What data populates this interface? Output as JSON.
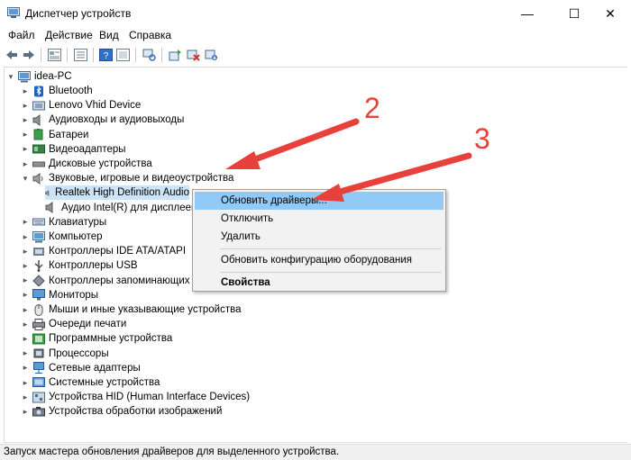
{
  "window": {
    "title": "Диспетчер устройств",
    "minimize": "—",
    "maximize": "☐",
    "close": "✕"
  },
  "menu": [
    "Файл",
    "Действие",
    "Вид",
    "Справка"
  ],
  "toolbar": {
    "icons": [
      "back-arrow-icon",
      "forward-arrow-icon",
      "properties-icon",
      "view-icon",
      "help-icon",
      "show-hidden-icon",
      "scan-hardware-icon",
      "update-driver-icon",
      "disable-device-icon",
      "uninstall-device-icon",
      "download-icon"
    ]
  },
  "tree": {
    "root": "idea-PC",
    "items": [
      {
        "label": "Bluetooth",
        "expanded": false,
        "icon": "bluetooth-icon"
      },
      {
        "label": "Lenovo Vhid Device",
        "expanded": false,
        "icon": "hid-device-icon"
      },
      {
        "label": "Аудиовходы и аудиовыходы",
        "expanded": false,
        "icon": "speaker-icon"
      },
      {
        "label": "Батареи",
        "expanded": false,
        "icon": "battery-icon"
      },
      {
        "label": "Видеоадаптеры",
        "expanded": false,
        "icon": "display-adapter-icon"
      },
      {
        "label": "Дисковые устройства",
        "expanded": false,
        "icon": "disk-drive-icon"
      },
      {
        "label": "Звуковые, игровые и видеоустройства",
        "expanded": true,
        "icon": "sound-icon"
      },
      {
        "label": "Realtek High Definition Audio",
        "child": true,
        "selected": true,
        "icon": "speaker-icon"
      },
      {
        "label": "Аудио Intel(R) для дисплеев",
        "child": true,
        "icon": "speaker-icon"
      },
      {
        "label": "Клавиатуры",
        "expanded": false,
        "icon": "keyboard-icon"
      },
      {
        "label": "Компьютер",
        "expanded": false,
        "icon": "computer-icon"
      },
      {
        "label": "Контроллеры IDE ATA/ATAPI",
        "expanded": false,
        "icon": "ide-controller-icon"
      },
      {
        "label": "Контроллеры USB",
        "expanded": false,
        "icon": "usb-icon"
      },
      {
        "label": "Контроллеры запоминающих устройств",
        "expanded": false,
        "icon": "storage-controller-icon"
      },
      {
        "label": "Мониторы",
        "expanded": false,
        "icon": "monitor-icon"
      },
      {
        "label": "Мыши и иные указывающие устройства",
        "expanded": false,
        "icon": "mouse-icon"
      },
      {
        "label": "Очереди печати",
        "expanded": false,
        "icon": "printer-icon"
      },
      {
        "label": "Программные устройства",
        "expanded": false,
        "icon": "software-device-icon"
      },
      {
        "label": "Процессоры",
        "expanded": false,
        "icon": "processor-icon"
      },
      {
        "label": "Сетевые адаптеры",
        "expanded": false,
        "icon": "network-adapter-icon"
      },
      {
        "label": "Системные устройства",
        "expanded": false,
        "icon": "system-device-icon"
      },
      {
        "label": "Устройства HID (Human Interface Devices)",
        "expanded": false,
        "icon": "hid-icon"
      },
      {
        "label": "Устройства обработки изображений",
        "expanded": false,
        "icon": "camera-icon"
      }
    ]
  },
  "context_menu": {
    "update": "Обновить драйверы...",
    "disable": "Отключить",
    "uninstall": "Удалить",
    "scan": "Обновить конфигурацию оборудования",
    "properties": "Свойства"
  },
  "status": "Запуск мастера обновления драйверов для выделенного устройства.",
  "annotations": {
    "n2": "2",
    "n3": "3",
    "color": "#e8403a"
  }
}
